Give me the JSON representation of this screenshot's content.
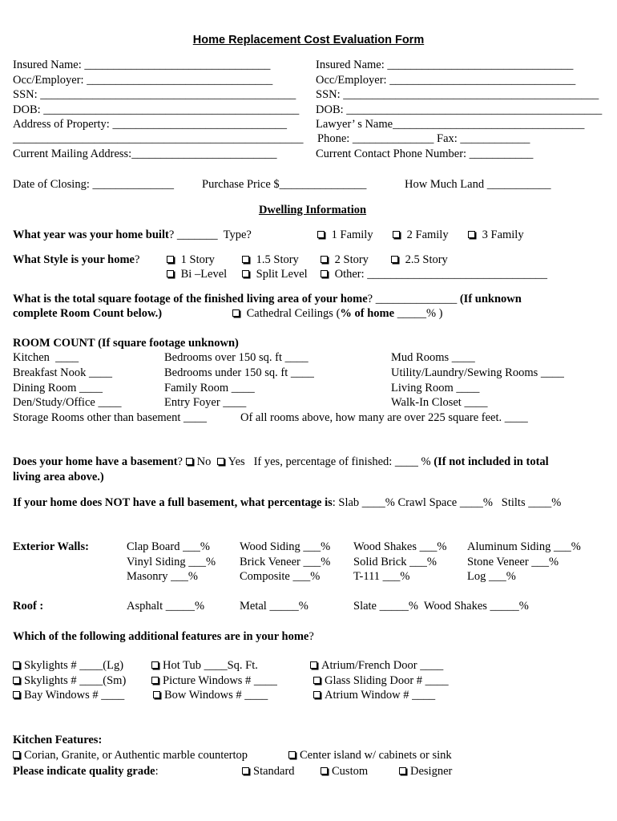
{
  "title": "Home Replacement Cost Evaluation Form",
  "left_block": [
    "Insured Name: ________________________________",
    "Occ/Employer: ________________________________",
    "SSN: ____________________________________________",
    "DOB: ____________________________________________",
    "Address of Property: ______________________________",
    "__________________________________________________",
    "Current Mailing Address:_________________________"
  ],
  "right_block": [
    "Insured Name: ________________________________",
    "Occ/Employer: ________________________________",
    "SSN: ____________________________________________",
    "DOB: ____________________________________________",
    "Lawyer’ s Name_________________________________",
    "Phone: ______________ Fax: ____________",
    "Current Contact Phone Number: ___________"
  ],
  "closing_row": {
    "date_of_closing": "Date of Closing: ______________",
    "purchase_price": "Purchase Price $_______________",
    "land": "How Much Land ___________"
  },
  "dwelling": {
    "heading": "Dwelling Information",
    "year_q": "What year was your home built",
    "year_rest": "? _______  Type?",
    "types": [
      "1 Family",
      "2 Family",
      "3 Family"
    ],
    "style_q": "What Style is your home",
    "style_q_end": "?",
    "styles_row1": [
      "1 Story",
      "1.5 Story",
      "2 Story",
      "2.5 Story"
    ],
    "styles_row2": [
      "Bi –Level",
      "Split Level",
      "Other: _______________________________"
    ],
    "sqft_q": "What is the total square footage of the finished living area of your home",
    "sqft_rest": "? ______________ ",
    "sqft_note1": "(If unknown",
    "sqft_note2": "complete Room Count below.)",
    "cathedral": "Cathedral Ceilings (",
    "cathedral_bold": "% of home",
    "cathedral_end": " _____% )"
  },
  "room_count": {
    "heading": "ROOM COUNT (If square footage unknown)",
    "col1": [
      "Kitchen  ____",
      "Breakfast Nook ____",
      "Dining Room ____",
      "Den/Study/Office ____"
    ],
    "col2": [
      "Bedrooms over 150 sq. ft ____",
      "Bedrooms under 150 sq. ft ____",
      "Family Room ____",
      "Entry Foyer ____"
    ],
    "col3": [
      "Mud Rooms ____",
      "Utility/Laundry/Sewing Rooms ____",
      "Living Room ____",
      "Walk-In Closet ____"
    ],
    "storage": "Storage Rooms other than basement ____",
    "over225": "Of all rooms above, how many are over 225 square feet. ____"
  },
  "basement": {
    "question": "Does your home have a basement",
    "q_end": "?",
    "options": [
      "No",
      "Yes"
    ],
    "finished": "If yes, percentage of finished: ____ % ",
    "note1": "(If not included in total",
    "note2": "living area above.)",
    "no_full_q": "If your home does NOT have a full basement, what percentage is",
    "no_full_rest": ": Slab ____% Crawl Space ____%   Stilts ____%"
  },
  "exterior": {
    "label": "Exterior Walls:",
    "rows": [
      [
        "Clap Board ___%",
        "Wood Siding ___%",
        "Wood Shakes ___%",
        "Aluminum Siding ___%"
      ],
      [
        "Vinyl Siding ___%",
        "Brick Veneer ___%",
        "Solid Brick ___%",
        "Stone Veneer ___%"
      ],
      [
        "Masonry ___%",
        "Composite ___%",
        "T-111 ___%",
        "Log ___%"
      ]
    ]
  },
  "roof": {
    "label": "Roof :",
    "items": [
      "Asphalt _____%",
      "Metal _____%",
      "Slate _____%  Wood Shakes _____%"
    ]
  },
  "features": {
    "question": "Which of the following additional features are in your home",
    "q_end": "?",
    "col1": [
      "Skylights # ____(Lg)",
      "Skylights # ____(Sm)",
      "Bay Windows # ____"
    ],
    "col2": [
      "Hot Tub ____Sq. Ft.",
      "Picture Windows # ____",
      "Bow Windows # ____"
    ],
    "col3": [
      "Atrium/French Door ____",
      "Glass Sliding Door # ____",
      "Atrium Window # ____"
    ]
  },
  "kitchen": {
    "heading": "Kitchen Features:",
    "options": [
      "Corian, Granite, or Authentic marble countertop",
      "Center island w/ cabinets or sink"
    ],
    "grade_label": "Please indicate quality grade",
    "grade_end": ":",
    "grades": [
      "Standard",
      "Custom",
      "Designer"
    ]
  }
}
